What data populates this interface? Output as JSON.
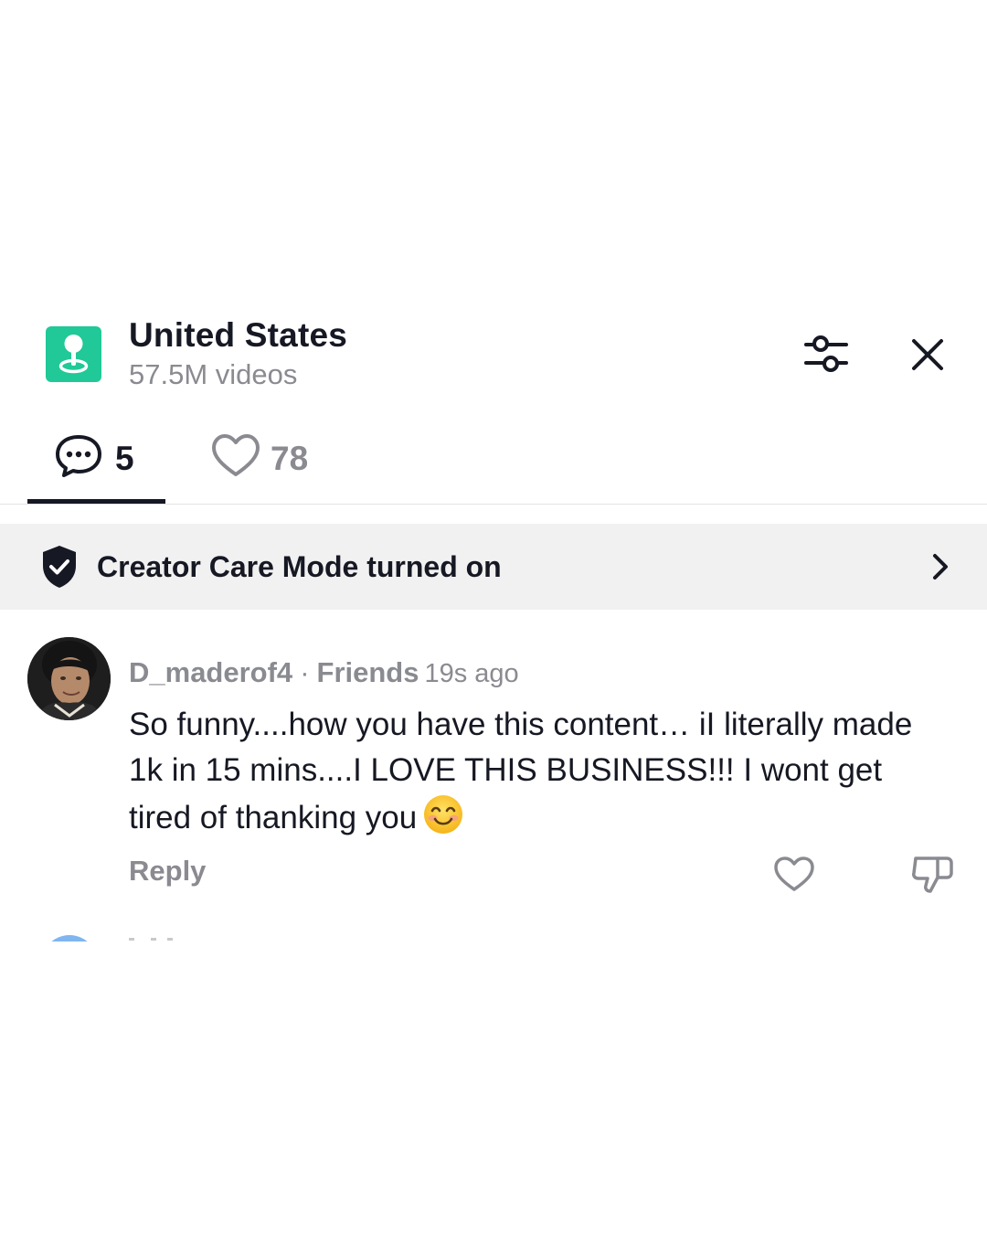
{
  "header": {
    "title": "United States",
    "subtitle": "57.5M videos",
    "location_icon": "location-pin-icon",
    "filter_icon": "sliders-icon",
    "close_icon": "close-icon",
    "accent_color": "#20c997"
  },
  "tabs": {
    "comments_count": "5",
    "likes_count": "78",
    "active": "comments"
  },
  "banner": {
    "text": "Creator Care Mode turned on",
    "icon": "shield-check-icon"
  },
  "comment": {
    "username": "D_maderof4",
    "separator": "·",
    "relation": "Friends",
    "time": "19s ago",
    "text": "So funny....how you have this content… iI literally made 1k in 15 mins....I LOVE THIS BUSINESS!!! I wont get tired of thanking you",
    "emoji": "smiling-face-icon",
    "reply_label": "Reply"
  }
}
